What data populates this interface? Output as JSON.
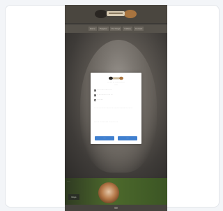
{
  "hero": {
    "title": "Ie··· ···et"
  },
  "nav": {
    "items": [
      "Home",
      "Puppies",
      "Our Dogs",
      "Gallery",
      "Contact"
    ]
  },
  "strip": {
    "label": "·····",
    "button_label": "Dogs"
  },
  "modal": {
    "heading": "··· ···· ··· ····· ··· ······",
    "subheading": "······",
    "options": [
      {
        "label": "···· ··· ····· ······ ···· ···",
        "checked": true
      },
      {
        "label": "··· ····· ········ ··· ···· ····",
        "checked": true
      },
      {
        "label": "······ ·····",
        "checked": false
      }
    ],
    "paragraph1": "··· ····· ······ ··· ····· ······ ···· ··· ····· ···· ····· ·········· ··· ····· ····",
    "paragraph2": "······ ···· ···· ····· ········ ···· ··· ····· ·· ···",
    "accept_label": "·····",
    "settings_label": "·····"
  },
  "colors": {
    "accent": "#3f7fcf",
    "page_bg": "#f3f5f8",
    "site_bg": "#3c3a37"
  }
}
